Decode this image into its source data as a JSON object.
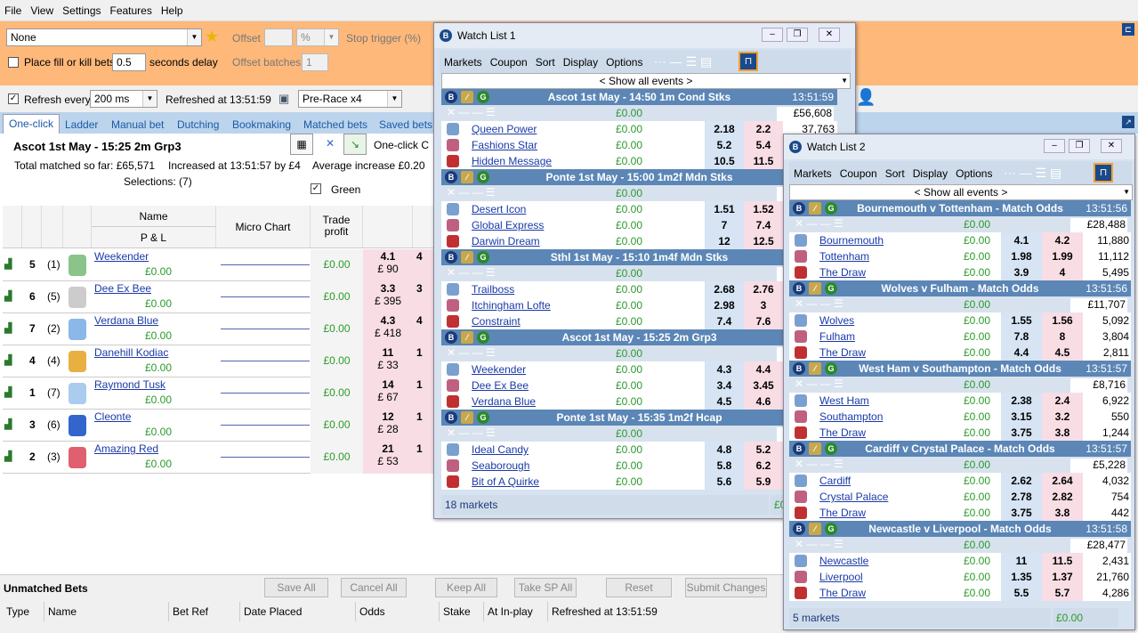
{
  "menu": [
    "File",
    "View",
    "Settings",
    "Features",
    "Help"
  ],
  "toolbar": {
    "strategy": "None",
    "offset_label": "Offset",
    "offset_unit": "%",
    "stop_trigger_label": "Stop trigger (%)",
    "fill_kill_label": "Place fill or kill bets",
    "fill_kill_value": "0.5",
    "seconds_delay": "seconds delay",
    "offset_batches_label": "Offset batches",
    "offset_batches_value": "1",
    "refresh_label": "Refresh every",
    "refresh_value": "200 ms",
    "refreshed_at": "Refreshed at 13:51:59",
    "view_mode": "Pre-Race x4"
  },
  "tabs": [
    "One-click",
    "Ladder",
    "Manual bet",
    "Dutching",
    "Bookmaking",
    "Matched bets",
    "Saved bets"
  ],
  "market": {
    "title": "Ascot 1st May - 15:25 2m Grp3",
    "one_click_label": "One-click C",
    "total_matched": "Total matched so far: £65,571",
    "increased": "Increased at 13:51:57 by £4",
    "avg_increase": "Average increase £0.20",
    "selections": "Selections: (7)",
    "green_label": "Green"
  },
  "grid_headers": {
    "name": "Name",
    "pl": "P & L",
    "micro": "Micro Chart",
    "trade": "Trade\nprofit"
  },
  "runners": [
    {
      "num": "5",
      "draw": "(1)",
      "name": "Weekender",
      "pl": "£0.00",
      "trade": "£0.00",
      "odds": "4.1",
      "matched": "£ 90",
      "col2": "4"
    },
    {
      "num": "6",
      "draw": "(5)",
      "name": "Dee Ex Bee",
      "pl": "£0.00",
      "trade": "£0.00",
      "odds": "3.3",
      "matched": "£ 395",
      "col2": "3"
    },
    {
      "num": "7",
      "draw": "(2)",
      "name": "Verdana Blue",
      "pl": "£0.00",
      "trade": "£0.00",
      "odds": "4.3",
      "matched": "£ 418",
      "col2": "4"
    },
    {
      "num": "4",
      "draw": "(4)",
      "name": "Danehill Kodiac",
      "pl": "£0.00",
      "trade": "£0.00",
      "odds": "11",
      "matched": "£ 33",
      "col2": "1"
    },
    {
      "num": "1",
      "draw": "(7)",
      "name": "Raymond Tusk",
      "pl": "£0.00",
      "trade": "£0.00",
      "odds": "14",
      "matched": "£ 67",
      "col2": "1"
    },
    {
      "num": "3",
      "draw": "(6)",
      "name": "Cleonte",
      "pl": "£0.00",
      "trade": "£0.00",
      "odds": "12",
      "matched": "£ 28",
      "col2": "1"
    },
    {
      "num": "2",
      "draw": "(3)",
      "name": "Amazing Red",
      "pl": "£0.00",
      "trade": "£0.00",
      "odds": "21",
      "matched": "£ 53",
      "col2": "1"
    }
  ],
  "unmatched": {
    "title": "Unmatched Bets",
    "buttons": [
      "Save All",
      "Cancel All",
      "Keep All",
      "Take SP All",
      "Reset",
      "Submit Changes"
    ],
    "columns": [
      "Type",
      "Name",
      "Bet Ref",
      "Date Placed",
      "Odds",
      "Stake",
      "At In-play",
      "Refreshed at 13:51:59"
    ]
  },
  "watch1": {
    "title": "Watch List 1",
    "menu": [
      "Markets",
      "Coupon",
      "Sort",
      "Display",
      "Options"
    ],
    "show_all": "< Show all events >",
    "status": "18 markets",
    "status_pl": "£0",
    "events": [
      {
        "name": "Ascot  1st May - 14:50 1m Cond Stks",
        "time": "13:51:59",
        "pl": "£0.00",
        "total": "£56,608",
        "runners": [
          {
            "name": "Queen Power",
            "pl": "£0.00",
            "back": "2.18",
            "lay": "2.2",
            "vol": "37,763"
          },
          {
            "name": "Fashions Star",
            "pl": "£0.00",
            "back": "5.2",
            "lay": "5.4",
            "vol": ""
          },
          {
            "name": "Hidden Message",
            "pl": "£0.00",
            "back": "10.5",
            "lay": "11.5",
            "vol": ""
          }
        ]
      },
      {
        "name": "Ponte  1st May - 15:00 1m2f Mdn Stks",
        "time": "",
        "pl": "£0.00",
        "total": "",
        "runners": [
          {
            "name": "Desert Icon",
            "pl": "£0.00",
            "back": "1.51",
            "lay": "1.52",
            "vol": ""
          },
          {
            "name": "Global Express",
            "pl": "£0.00",
            "back": "7",
            "lay": "7.4",
            "vol": ""
          },
          {
            "name": "Darwin Dream",
            "pl": "£0.00",
            "back": "12",
            "lay": "12.5",
            "vol": ""
          }
        ]
      },
      {
        "name": "Sthl  1st May - 15:10 1m4f Mdn Stks",
        "time": "",
        "pl": "£0.00",
        "total": "",
        "runners": [
          {
            "name": "Trailboss",
            "pl": "£0.00",
            "back": "2.68",
            "lay": "2.76",
            "vol": ""
          },
          {
            "name": "Itchingham Lofte",
            "pl": "£0.00",
            "back": "2.98",
            "lay": "3",
            "vol": ""
          },
          {
            "name": "Constraint",
            "pl": "£0.00",
            "back": "7.4",
            "lay": "7.6",
            "vol": ""
          }
        ]
      },
      {
        "name": "Ascot  1st May - 15:25 2m Grp3",
        "time": "",
        "pl": "£0.00",
        "total": "",
        "runners": [
          {
            "name": "Weekender",
            "pl": "£0.00",
            "back": "4.3",
            "lay": "4.4",
            "vol": ""
          },
          {
            "name": "Dee Ex Bee",
            "pl": "£0.00",
            "back": "3.4",
            "lay": "3.45",
            "vol": ""
          },
          {
            "name": "Verdana Blue",
            "pl": "£0.00",
            "back": "4.5",
            "lay": "4.6",
            "vol": ""
          }
        ]
      },
      {
        "name": "Ponte  1st May - 15:35 1m2f Hcap",
        "time": "",
        "pl": "£0.00",
        "total": "",
        "runners": [
          {
            "name": "Ideal Candy",
            "pl": "£0.00",
            "back": "4.8",
            "lay": "5.2",
            "vol": ""
          },
          {
            "name": "Seaborough",
            "pl": "£0.00",
            "back": "5.8",
            "lay": "6.2",
            "vol": ""
          },
          {
            "name": "Bit of A Quirke",
            "pl": "£0.00",
            "back": "5.6",
            "lay": "5.9",
            "vol": ""
          }
        ]
      }
    ]
  },
  "watch2": {
    "title": "Watch List 2",
    "menu": [
      "Markets",
      "Coupon",
      "Sort",
      "Display",
      "Options"
    ],
    "show_all": "< Show all events >",
    "status": "5 markets",
    "status_pl": "£0.00",
    "events": [
      {
        "name": "Bournemouth v Tottenham - Match Odds",
        "time": "13:51:56",
        "pl": "£0.00",
        "total": "£28,488",
        "runners": [
          {
            "name": "Bournemouth",
            "pl": "£0.00",
            "back": "4.1",
            "lay": "4.2",
            "vol": "11,880"
          },
          {
            "name": "Tottenham",
            "pl": "£0.00",
            "back": "1.98",
            "lay": "1.99",
            "vol": "11,112"
          },
          {
            "name": "The Draw",
            "pl": "£0.00",
            "back": "3.9",
            "lay": "4",
            "vol": "5,495"
          }
        ]
      },
      {
        "name": "Wolves v Fulham - Match Odds",
        "time": "13:51:56",
        "pl": "£0.00",
        "total": "£11,707",
        "runners": [
          {
            "name": "Wolves",
            "pl": "£0.00",
            "back": "1.55",
            "lay": "1.56",
            "vol": "5,092"
          },
          {
            "name": "Fulham",
            "pl": "£0.00",
            "back": "7.8",
            "lay": "8",
            "vol": "3,804"
          },
          {
            "name": "The Draw",
            "pl": "£0.00",
            "back": "4.4",
            "lay": "4.5",
            "vol": "2,811"
          }
        ]
      },
      {
        "name": "West Ham v Southampton - Match Odds",
        "time": "13:51:57",
        "pl": "£0.00",
        "total": "£8,716",
        "runners": [
          {
            "name": "West Ham",
            "pl": "£0.00",
            "back": "2.38",
            "lay": "2.4",
            "vol": "6,922"
          },
          {
            "name": "Southampton",
            "pl": "£0.00",
            "back": "3.15",
            "lay": "3.2",
            "vol": "550"
          },
          {
            "name": "The Draw",
            "pl": "£0.00",
            "back": "3.75",
            "lay": "3.8",
            "vol": "1,244"
          }
        ]
      },
      {
        "name": "Cardiff v Crystal Palace - Match Odds",
        "time": "13:51:57",
        "pl": "£0.00",
        "total": "£5,228",
        "runners": [
          {
            "name": "Cardiff",
            "pl": "£0.00",
            "back": "2.62",
            "lay": "2.64",
            "vol": "4,032"
          },
          {
            "name": "Crystal Palace",
            "pl": "£0.00",
            "back": "2.78",
            "lay": "2.82",
            "vol": "754"
          },
          {
            "name": "The Draw",
            "pl": "£0.00",
            "back": "3.75",
            "lay": "3.8",
            "vol": "442"
          }
        ]
      },
      {
        "name": "Newcastle v Liverpool - Match Odds",
        "time": "13:51:58",
        "pl": "£0.00",
        "total": "£28,477",
        "runners": [
          {
            "name": "Newcastle",
            "pl": "£0.00",
            "back": "11",
            "lay": "11.5",
            "vol": "2,431"
          },
          {
            "name": "Liverpool",
            "pl": "£0.00",
            "back": "1.35",
            "lay": "1.37",
            "vol": "21,760"
          },
          {
            "name": "The Draw",
            "pl": "£0.00",
            "back": "5.5",
            "lay": "5.7",
            "vol": "4,286"
          }
        ]
      }
    ]
  },
  "colors": {
    "orange": "#fdb87a",
    "event_header": "#5b86b6",
    "back": "#d6e4f4",
    "lay": "#f8dde5",
    "green": "#2a9a2a",
    "link": "#1a3aa8"
  }
}
